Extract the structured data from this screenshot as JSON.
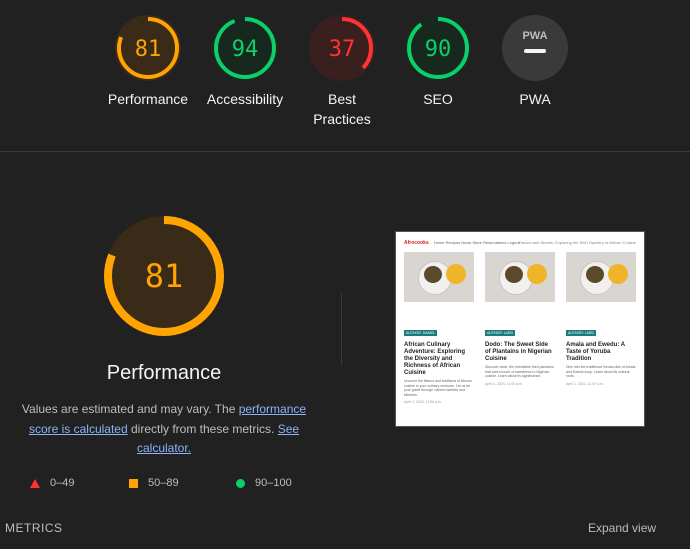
{
  "gauges": [
    {
      "label": "Performance",
      "score": "81",
      "value": 81,
      "color": "#ffa400",
      "bg": "#3a2b19"
    },
    {
      "label": "Accessibility",
      "score": "94",
      "value": 94,
      "color": "#0cce6b",
      "bg": "#17291f"
    },
    {
      "label": "Best Practices",
      "score": "37",
      "value": 37,
      "color": "#ff3333",
      "bg": "#3a1f1f"
    },
    {
      "label": "SEO",
      "score": "90",
      "value": 90,
      "color": "#0cce6b",
      "bg": "#17291f"
    },
    {
      "label": "PWA",
      "badge": "PWA",
      "color": "#9e9e9e",
      "bg": "#3a3a3a"
    }
  ],
  "main": {
    "score": "81",
    "value": 81,
    "color": "#ffa400",
    "title": "Performance",
    "note_prefix": "Values are estimated and may vary. The ",
    "note_link1": "performance score is calculated",
    "note_middle": " directly from these metrics. ",
    "note_link2": "See calculator."
  },
  "legend": [
    {
      "shape": "triangle",
      "range": "0–49",
      "color": "#ff3333"
    },
    {
      "shape": "square",
      "range": "50–89",
      "color": "#ffa400"
    },
    {
      "shape": "circle",
      "range": "90–100",
      "color": "#0cce6b"
    }
  ],
  "screenshot": {
    "logo": "Afrocooks",
    "nav": "Home  Recipes  News  Store  Reservations  Logout",
    "tagline": "Flavors and Stories: Exploring the Rich Tapestry of African Cuisine",
    "cards": [
      {
        "badge": "AUTHOR: DANIEL",
        "title": "African Culinary Adventure: Exploring the Diversity and Richness of African Cuisine",
        "body": "Uncover the flavors and traditions of African cuisine in your culinary ventures. Let us be your guide through vibrant markets and kitchens.",
        "date": "April 1, 2024, 11:56 a.m."
      },
      {
        "badge": "AUTHOR: LARD",
        "title": "Dodo: The Sweet Side of Plantains in Nigerian Cuisine",
        "body": "Discover dodo, the irresistible fried plantains that add a touch of sweetness to Nigerian cuisine. Learn about its significance.",
        "date": "April 1, 2024, 11:00 a.m."
      },
      {
        "badge": "AUTHOR: LARD",
        "title": "Amala and Ewedu: A Taste of Yoruba Tradition",
        "body": "Dive into the traditional Yoruba dish of Amala and Ewedu soup. Learn about its cultural roots.",
        "date": "April 1, 2024, 11:57 a.m."
      }
    ]
  },
  "footer": {
    "metrics": "METRICS",
    "expand": "Expand view"
  }
}
